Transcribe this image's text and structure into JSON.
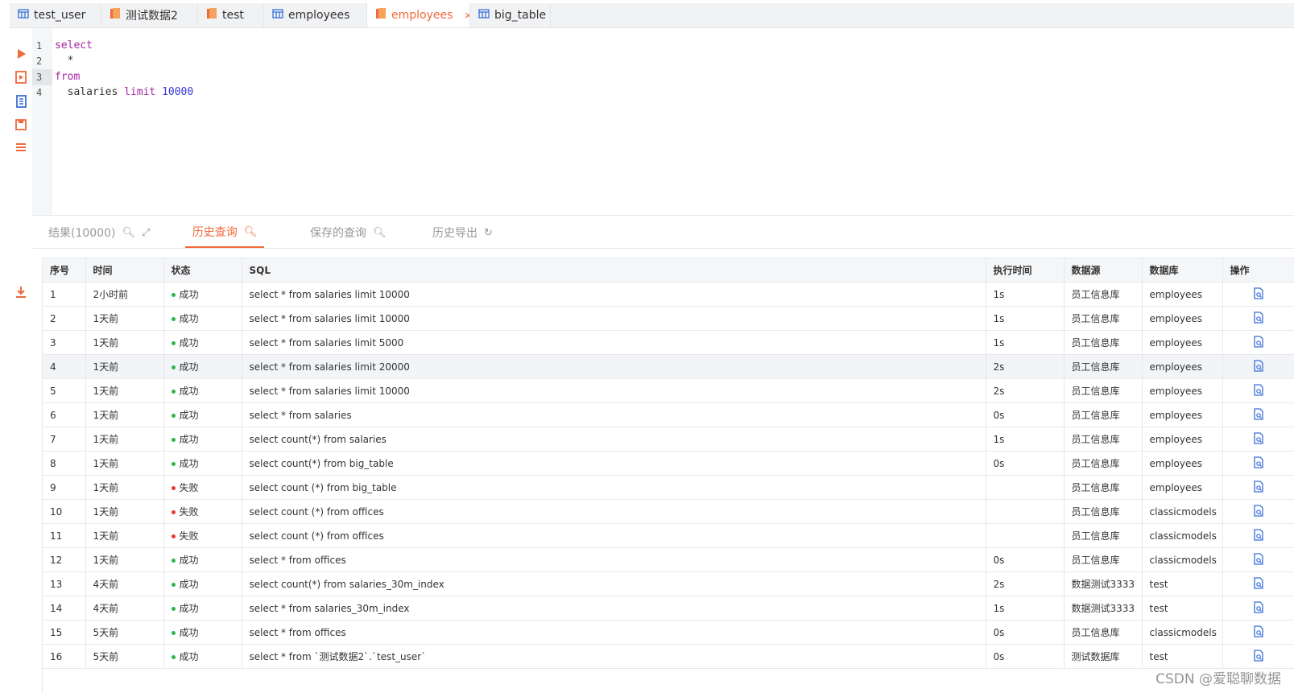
{
  "tabs": [
    {
      "label": "test_user",
      "icon": "table-icon",
      "width": 114
    },
    {
      "label": "测试数据2",
      "icon": "database-icon",
      "width": 120
    },
    {
      "label": "test",
      "icon": "database-icon",
      "width": 82
    },
    {
      "label": "employees",
      "icon": "table-icon",
      "width": 128
    },
    {
      "label": "employees",
      "icon": "database-icon",
      "width": 128,
      "active": true,
      "close": "×"
    },
    {
      "label": "big_table",
      "icon": "table-icon",
      "width": 100
    }
  ],
  "editor": {
    "lines": [
      "1",
      "2",
      "3",
      "4"
    ]
  },
  "result_tabs": {
    "results": "结果(10000)",
    "history": "历史查询",
    "saved": "保存的查询",
    "export": "历史导出"
  },
  "table": {
    "headers": [
      "序号",
      "时间",
      "状态",
      "SQL",
      "执行时间",
      "数据源",
      "数据库",
      "操作"
    ],
    "rows": [
      {
        "n": "1",
        "time": "2小时前",
        "status": "成功",
        "ok": true,
        "sql": "select * from salaries limit 10000",
        "dur": "1s",
        "src": "员工信息库",
        "db": "employees"
      },
      {
        "n": "2",
        "time": "1天前",
        "status": "成功",
        "ok": true,
        "sql": "select * from salaries limit 10000",
        "dur": "1s",
        "src": "员工信息库",
        "db": "employees"
      },
      {
        "n": "3",
        "time": "1天前",
        "status": "成功",
        "ok": true,
        "sql": "select * from salaries limit 5000",
        "dur": "1s",
        "src": "员工信息库",
        "db": "employees"
      },
      {
        "n": "4",
        "time": "1天前",
        "status": "成功",
        "ok": true,
        "sql": "select * from salaries limit 20000",
        "dur": "2s",
        "src": "员工信息库",
        "db": "employees"
      },
      {
        "n": "5",
        "time": "1天前",
        "status": "成功",
        "ok": true,
        "sql": "select * from salaries limit 10000",
        "dur": "2s",
        "src": "员工信息库",
        "db": "employees"
      },
      {
        "n": "6",
        "time": "1天前",
        "status": "成功",
        "ok": true,
        "sql": "select * from salaries",
        "dur": "0s",
        "src": "员工信息库",
        "db": "employees"
      },
      {
        "n": "7",
        "time": "1天前",
        "status": "成功",
        "ok": true,
        "sql": "select count(*) from salaries",
        "dur": "1s",
        "src": "员工信息库",
        "db": "employees"
      },
      {
        "n": "8",
        "time": "1天前",
        "status": "成功",
        "ok": true,
        "sql": "select count(*) from big_table",
        "dur": "0s",
        "src": "员工信息库",
        "db": "employees"
      },
      {
        "n": "9",
        "time": "1天前",
        "status": "失败",
        "ok": false,
        "sql": "select count (*) from big_table",
        "dur": "",
        "src": "员工信息库",
        "db": "employees"
      },
      {
        "n": "10",
        "time": "1天前",
        "status": "失败",
        "ok": false,
        "sql": "select count (*) from offices",
        "dur": "",
        "src": "员工信息库",
        "db": "classicmodels"
      },
      {
        "n": "11",
        "time": "1天前",
        "status": "失败",
        "ok": false,
        "sql": "select count (*) from offices",
        "dur": "",
        "src": "员工信息库",
        "db": "classicmodels"
      },
      {
        "n": "12",
        "time": "1天前",
        "status": "成功",
        "ok": true,
        "sql": "select * from offices",
        "dur": "0s",
        "src": "员工信息库",
        "db": "classicmodels"
      },
      {
        "n": "13",
        "time": "4天前",
        "status": "成功",
        "ok": true,
        "sql": "select count(*) from salaries_30m_index",
        "dur": "2s",
        "src": "数据测试3333",
        "db": "test"
      },
      {
        "n": "14",
        "time": "4天前",
        "status": "成功",
        "ok": true,
        "sql": "select * from salaries_30m_index",
        "dur": "1s",
        "src": "数据测试3333",
        "db": "test"
      },
      {
        "n": "15",
        "time": "5天前",
        "status": "成功",
        "ok": true,
        "sql": "select * from offices",
        "dur": "0s",
        "src": "员工信息库",
        "db": "classicmodels"
      },
      {
        "n": "16",
        "time": "5天前",
        "status": "成功",
        "ok": true,
        "sql": "select * from `测试数据2`.`test_user`",
        "dur": "0s",
        "src": "测试数据库",
        "db": "test"
      }
    ]
  },
  "watermark": "CSDN @爱聪聊数据",
  "colors": {
    "accent": "#ee6a3a",
    "success": "#2fb34a",
    "fail": "#e53935",
    "link": "#3a6fd8"
  }
}
